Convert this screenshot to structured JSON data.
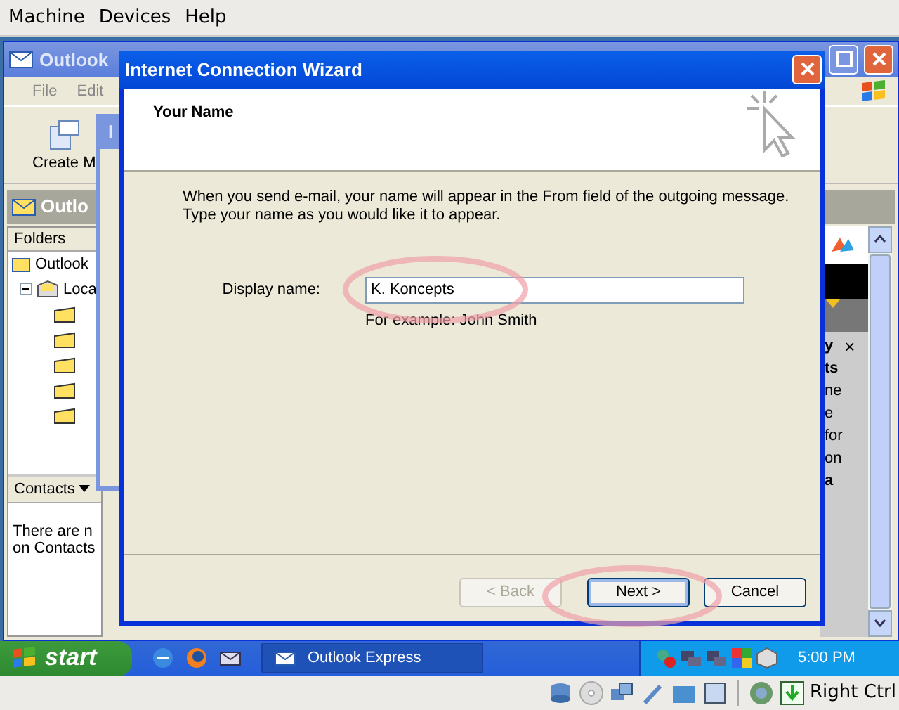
{
  "host_menu": [
    {
      "label": "Machine"
    },
    {
      "label": "Devices"
    },
    {
      "label": "Help"
    }
  ],
  "outlook": {
    "title": "Outlook",
    "menu": [
      "File",
      "Edit"
    ],
    "toolbar": [
      "Create M"
    ],
    "folder_bar": "Outlo",
    "folders_header": "Folders",
    "folders": [
      {
        "label": "Outlook",
        "children": [
          {
            "label": "Loca",
            "expanded": true
          }
        ]
      }
    ],
    "contacts": {
      "label": "Contacts",
      "message_lines": [
        "There are n",
        "on Contacts"
      ]
    },
    "side_lines": [
      {
        "text": "y",
        "bold": true,
        "close": "×"
      },
      {
        "text": "ts",
        "bold": true
      },
      {
        "text": "ne",
        "bold": false
      },
      {
        "text": "e",
        "bold": false
      },
      {
        "text": "for",
        "bold": false
      },
      {
        "text": "on",
        "bold": false
      },
      {
        "text": "a",
        "bold": true
      }
    ]
  },
  "behind_window": {
    "title": "I"
  },
  "wizard": {
    "title": "Internet Connection Wizard",
    "heading": "Your Name",
    "intro_lines": [
      "When you send e-mail, your name will appear in the From field of the outgoing message.",
      "Type your name as you would like it to appear."
    ],
    "field": {
      "label": "Display name:",
      "value": "K. Koncepts",
      "example": "For example: John Smith"
    },
    "buttons": [
      {
        "label": "< Back",
        "disabled": true,
        "default": false
      },
      {
        "label": "Next >",
        "disabled": false,
        "default": true
      },
      {
        "label": "Cancel",
        "disabled": false,
        "default": false
      }
    ]
  },
  "taskbar": {
    "start": "start",
    "tasks": [
      {
        "label": "Outlook Express"
      }
    ],
    "clock": "5:00 PM"
  },
  "host_status": {
    "hotkey": "Right Ctrl"
  }
}
